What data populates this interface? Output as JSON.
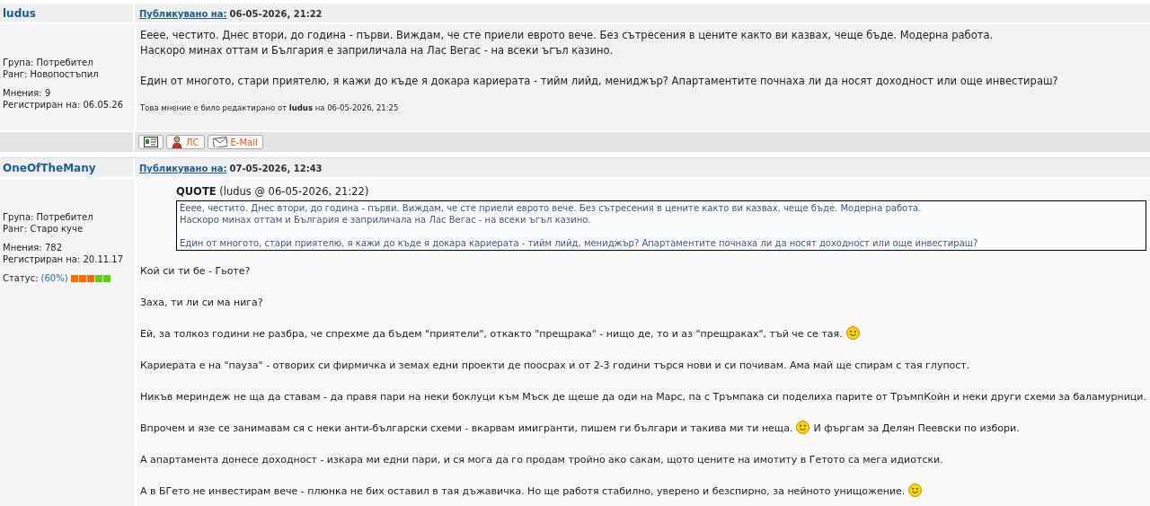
{
  "posts": [
    {
      "author": "ludus",
      "posted_label": "Публикувано на:",
      "posted_at": "06-05-2026, 21:22",
      "group": "Група: Потребител",
      "rank": "Ранг: Новопостъпил",
      "posts_count": "Мнения: 9",
      "registered": "Регистриран на: 06.05.26",
      "paragraphs": [
        [
          "Ееее, честито. Днес втори, до година - първи. Виждам, че сте приели еврото вече. Без сътресения в цените както ви казвах, чеще бъде. Модерна работа.",
          "Наскоро минах оттам и България е заприличала на Лас Вегас - на всеки ъгъл казино."
        ],
        [
          "Един от многото, стари приятелю, я кажи до къде я докара кариерата - тийм лийд, мениджър? Апартаментите почнаха ли да носят доходност или още инвестираш?"
        ]
      ],
      "edit_note": "Това мнение е било редактирано от **ludus** на 06-05-2026, 21:25",
      "buttons": [
        {
          "kind": "profile"
        },
        {
          "kind": "pm",
          "label": "ЛС"
        },
        {
          "kind": "email",
          "label": "E-Mail"
        }
      ]
    },
    {
      "author": "OneOfTheMany",
      "posted_label": "Публикувано на:",
      "posted_at": "07-05-2026, 12:43",
      "group": "Група: Потребител",
      "rank": "Ранг: Старо куче",
      "posts_count": "Мнения: 782",
      "registered": "Регистриран на: 20.11.17",
      "status": {
        "label": "Статус:",
        "percent": "(60%)",
        "level": 0.6
      },
      "quote": {
        "title": "QUOTE",
        "source": "(ludus @ 06-05-2026, 21:22)",
        "paragraphs": [
          [
            "Ееее, честито. Днес втори, до година - първи. Виждам, че сте приели еврото вече. Без сътресения в цените както ви казвах, чеще бъде. Модерна работа.",
            "Наскоро минах оттам и България е заприличала на Лас Вегас - на всеки ъгъл казино."
          ],
          [
            "Един от многото, стари приятелю, я кажи до къде я докара кариерата - тийм лийд, мениджър? Апартаментите почнаха ли да носят доходност или още инвестираш?"
          ]
        ]
      },
      "body": [
        [
          {
            "kind": "text",
            "text": "Кой си ти бе - Гьоте?"
          }
        ],
        [
          {
            "kind": "text",
            "text": "Заха, ти ли си ма нига?"
          }
        ],
        [
          {
            "kind": "text",
            "text": "Ей, за толкоз години не разбра, че спрехме да бъдем \"приятели\", откакто \"прещрака\" - нищо де, то и аз \"прещраках\", тъй че се тая."
          },
          {
            "kind": "smiley"
          }
        ],
        [
          {
            "kind": "text",
            "text": "Кариерата е на \"пауза\" - отворих си фирмичка и земах едни проекти де поосрах и от 2-3 години търся нови и си почивам. Ама май ще спирам с тая глупост."
          }
        ],
        [
          {
            "kind": "text",
            "text": "Никъв мериндеж не ща да ставам - да правя пари на неки боклуци към Мъск де щеше да оди на Марс, па с Тръмпака си поделиха парите от ТръмпКойн и неки други схеми за баламурници."
          }
        ],
        [
          {
            "kind": "text",
            "text": "Впрочем и язе се занимавам ся с неки анти-български схеми - вкарвам имигранти, пишем ги българи и такива ми ти неща."
          },
          {
            "kind": "smiley"
          },
          {
            "kind": "text",
            "text": "И фъргам за Делян Пеевски по избори."
          }
        ],
        [
          {
            "kind": "text",
            "text": "А апартамента донесе доходност - изкара ми едни пари, и ся мога да го продам тройно ако сакам, щото цените на имотиту в Гетото са мега идиотски."
          }
        ],
        [
          {
            "kind": "text",
            "text": "А в БГето не инвестирам вече - плюнка не бих оставил в тая дъжавичка. Но ще работя стабилно, уверено и безспирно, за нейното унищожение."
          },
          {
            "kind": "smiley"
          }
        ]
      ]
    }
  ]
}
